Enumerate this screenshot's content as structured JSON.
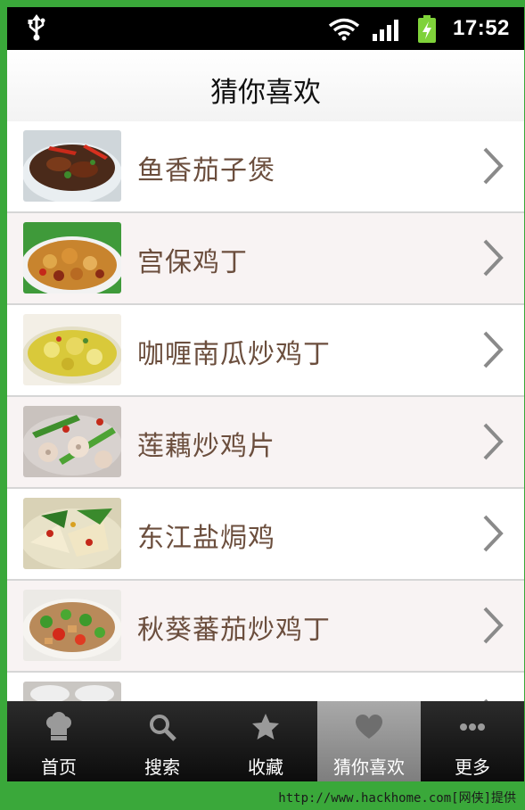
{
  "status_bar": {
    "time": "17:52",
    "icons": [
      "usb-icon",
      "wifi-icon",
      "signal-icon",
      "battery-charging-icon"
    ]
  },
  "header": {
    "title": "猜你喜欢"
  },
  "list": {
    "items": [
      {
        "label": "鱼香茄子煲",
        "icon": "chevron-right-icon"
      },
      {
        "label": "宫保鸡丁",
        "icon": "chevron-right-icon"
      },
      {
        "label": "咖喱南瓜炒鸡丁",
        "icon": "chevron-right-icon"
      },
      {
        "label": "莲藕炒鸡片",
        "icon": "chevron-right-icon"
      },
      {
        "label": "东江盐焗鸡",
        "icon": "chevron-right-icon"
      },
      {
        "label": "秋葵蕃茄炒鸡丁",
        "icon": "chevron-right-icon"
      }
    ]
  },
  "tab_bar": {
    "tabs": [
      {
        "label": "首页",
        "icon": "chef-hat-icon"
      },
      {
        "label": "搜索",
        "icon": "search-icon"
      },
      {
        "label": "收藏",
        "icon": "star-icon"
      },
      {
        "label": "猜你喜欢",
        "icon": "heart-icon",
        "active": true
      },
      {
        "label": "更多",
        "icon": "more-dots-icon"
      }
    ]
  },
  "footer": {
    "watermark": "http://www.hackhome.com[网侠]提供"
  },
  "colors": {
    "frame": "#3aa83a",
    "item_text": "#6b4e3d",
    "tab_bar": "#1a1a1a",
    "active_tab": "#9a9a9a"
  }
}
